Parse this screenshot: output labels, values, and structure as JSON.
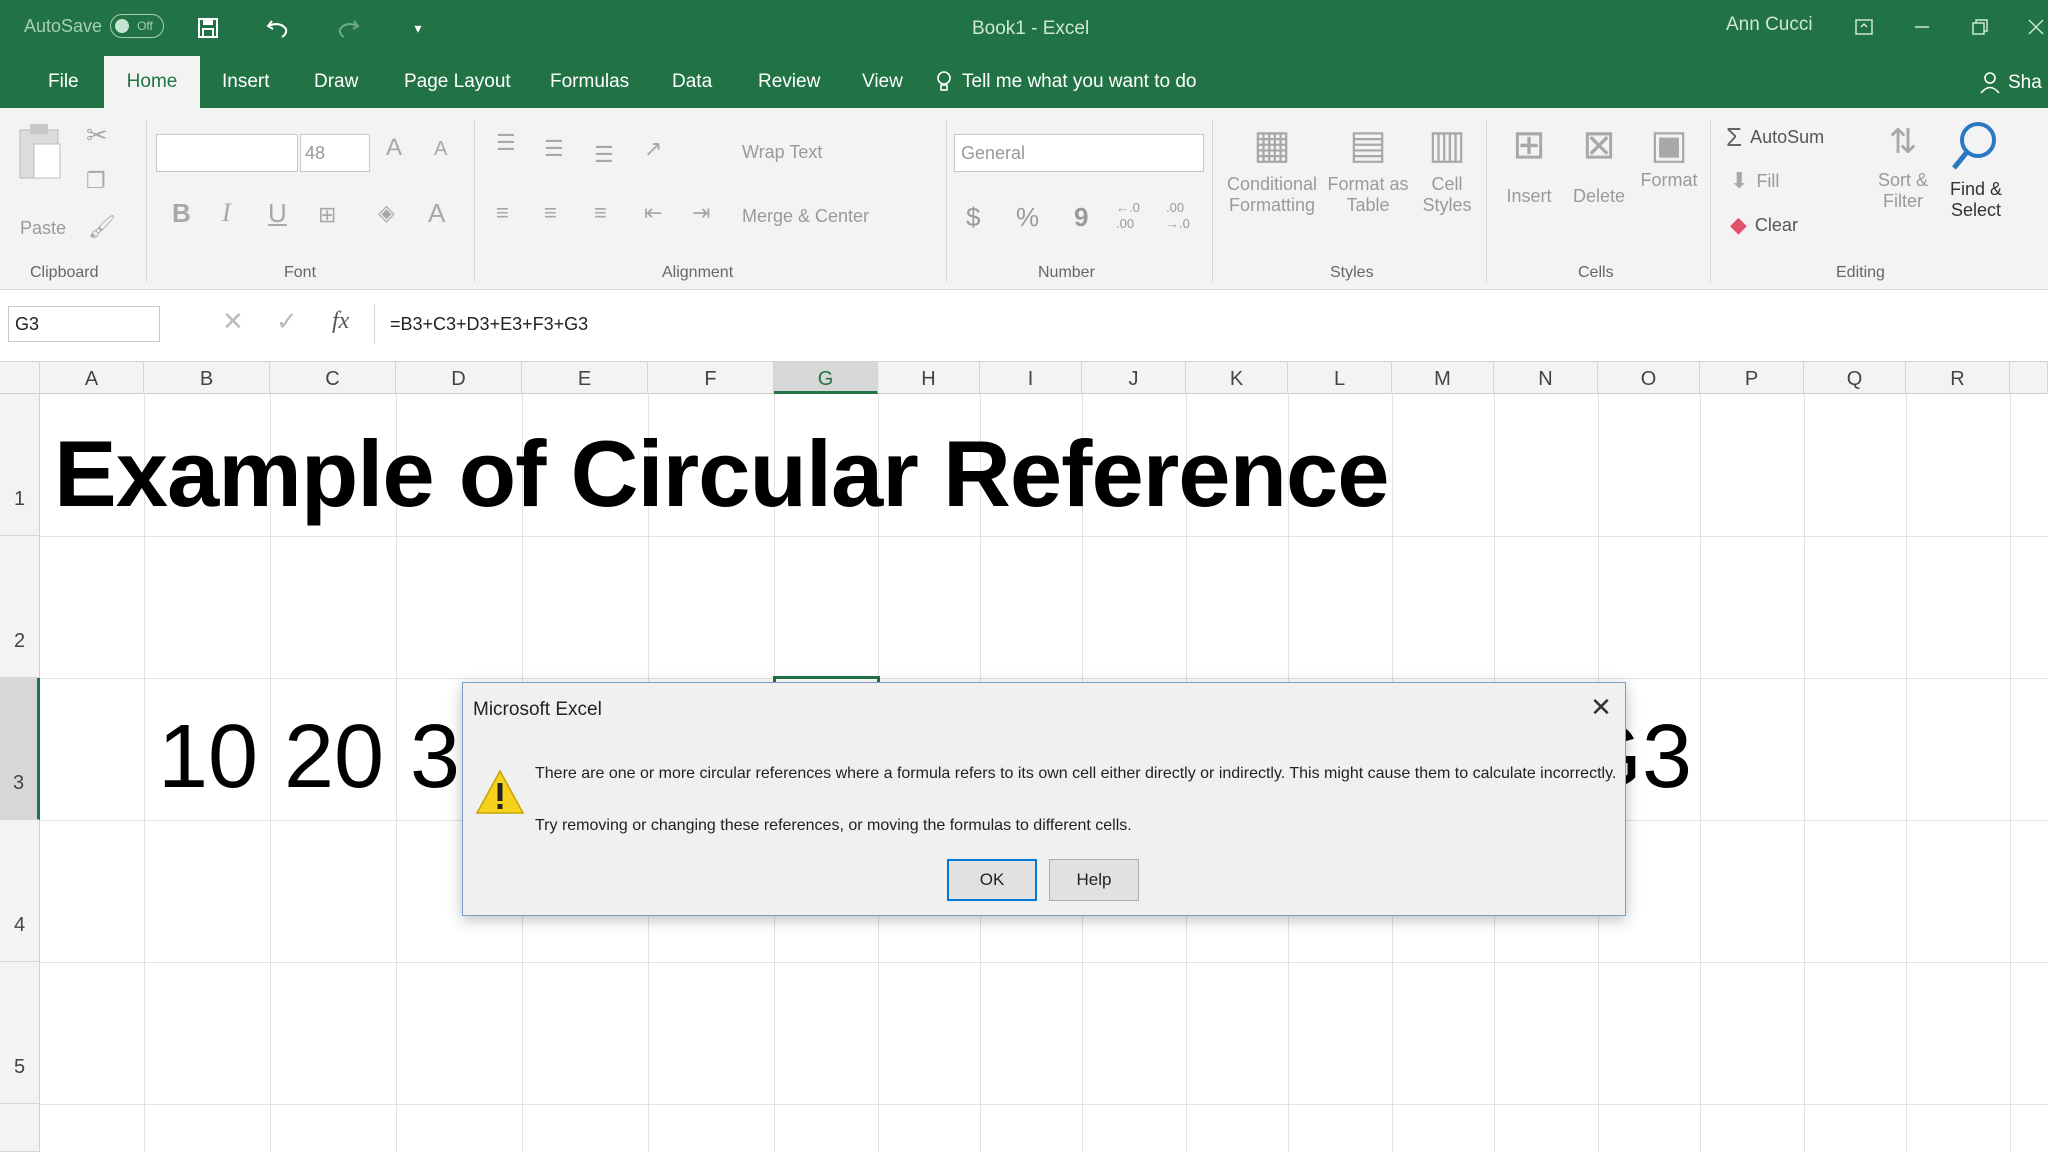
{
  "titlebar": {
    "autosave_label": "AutoSave",
    "autosave_state": "Off",
    "doc_title": "Book1  -  Excel",
    "user": "Ann Cucci"
  },
  "tabs": [
    "File",
    "Home",
    "Insert",
    "Draw",
    "Page Layout",
    "Formulas",
    "Data",
    "Review",
    "View"
  ],
  "active_tab": "Home",
  "tell_me": "Tell me what you want to do",
  "share": "Sha",
  "ribbon": {
    "clipboard": {
      "label": "Clipboard",
      "paste": "Paste"
    },
    "font": {
      "label": "Font",
      "size": "48",
      "font_name": ""
    },
    "alignment": {
      "label": "Alignment",
      "wrap": "Wrap Text",
      "merge": "Merge & Center"
    },
    "number": {
      "label": "Number",
      "format": "General",
      "currency": "$",
      "percent": "%",
      "comma": "9",
      "inc": "←.0 .00",
      "dec": ".00 →.0"
    },
    "styles": {
      "label": "Styles",
      "cond": "Conditional",
      "cond2": "Formatting",
      "fmt_table": "Format as",
      "fmt_table2": "Table",
      "cell": "Cell",
      "cell2": "Styles"
    },
    "cells": {
      "label": "Cells",
      "insert": "Insert",
      "delete": "Delete",
      "format": "Format"
    },
    "editing": {
      "label": "Editing",
      "autosum": "AutoSum",
      "fill": "Fill",
      "clear": "Clear",
      "sort": "Sort &",
      "sort2": "Filter",
      "find": "Find &",
      "find2": "Select"
    }
  },
  "formula_bar": {
    "name_box": "G3",
    "formula": "=B3+C3+D3+E3+F3+G3",
    "fx": "fx"
  },
  "columns": [
    "A",
    "B",
    "C",
    "D",
    "E",
    "F",
    "G",
    "H",
    "I",
    "J",
    "K",
    "L",
    "M",
    "N",
    "O",
    "P",
    "Q",
    "R"
  ],
  "selected_column": "G",
  "rows": [
    "1",
    "2",
    "3",
    "4",
    "5"
  ],
  "selected_row": "3",
  "cells": {
    "A1": "Example of Circular Reference",
    "B3": "10",
    "C3": "20",
    "D3": "3",
    "H3": "G3"
  },
  "dialog": {
    "title": "Microsoft Excel",
    "message1": "There are one or more circular references where a formula refers to its own cell either directly or indirectly. This might cause them to calculate incorrectly.",
    "message2": "Try removing or changing these references, or moving the formulas to different cells.",
    "ok": "OK",
    "help": "Help"
  }
}
